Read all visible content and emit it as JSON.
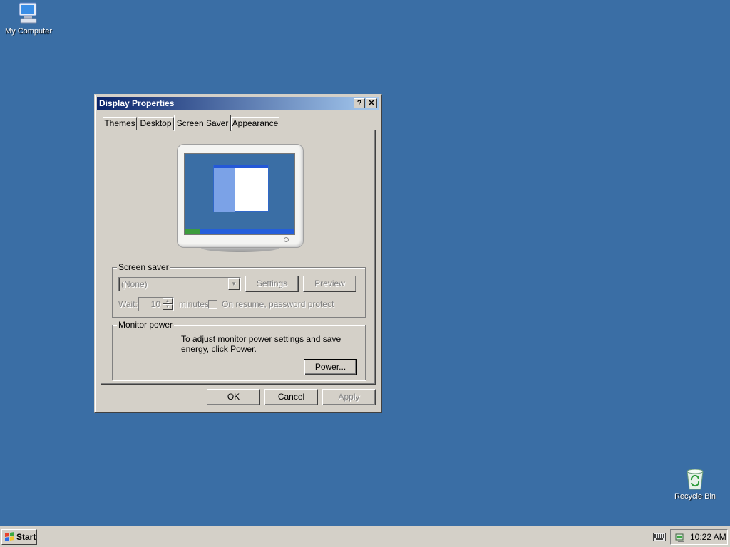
{
  "desktop": {
    "icons": [
      {
        "label": "My Computer",
        "icon": "my-computer-icon"
      },
      {
        "label": "Recycle Bin",
        "icon": "recycle-bin-icon"
      }
    ]
  },
  "window": {
    "title": "Display Properties",
    "help_btn": "?",
    "close_btn": "✕",
    "tabs": [
      {
        "label": "Themes"
      },
      {
        "label": "Desktop"
      },
      {
        "label": "Screen Saver",
        "active": true
      },
      {
        "label": "Appearance"
      }
    ],
    "screen_saver": {
      "group_label": "Screen saver",
      "selected": "(None)",
      "settings_label": "Settings",
      "preview_label": "Preview",
      "wait_label": "Wait:",
      "wait_value": "10",
      "minutes_label": "minutes",
      "password_label": "On resume, password protect",
      "password_checked": false,
      "disabled": true
    },
    "monitor_power": {
      "group_label": "Monitor power",
      "description": "To adjust monitor power settings and save energy, click Power.",
      "power_label": "Power..."
    },
    "buttons": {
      "ok": "OK",
      "cancel": "Cancel",
      "apply": "Apply"
    }
  },
  "taskbar": {
    "start_label": "Start",
    "clock": "10:22 AM"
  },
  "colors": {
    "desktop": "#3a6ea5",
    "face": "#d4d0c8",
    "title_start": "#0a246a",
    "title_end": "#a6caf0"
  }
}
